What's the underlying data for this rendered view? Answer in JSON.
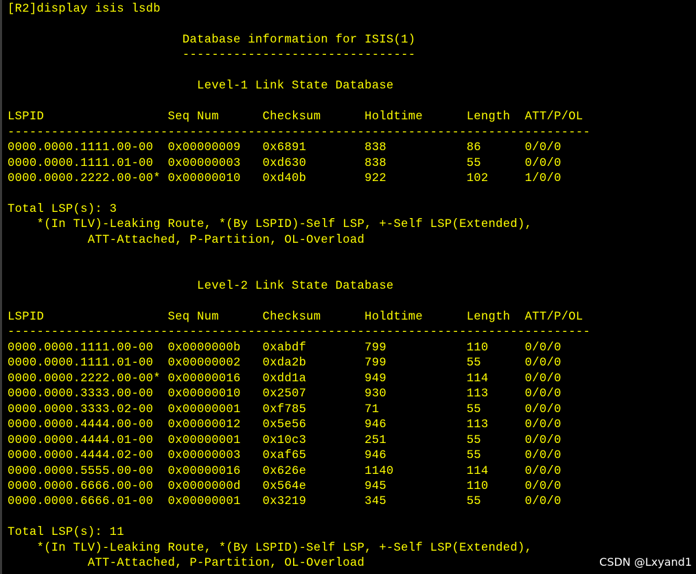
{
  "window": {
    "title": "",
    "watermark": "CSDN @Lxyand1"
  },
  "terminal": {
    "lines": [
      "[R2]display isis lsdb",
      "",
      "                        Database information for ISIS(1)",
      "                        --------------------------------",
      "",
      "                          Level-1 Link State Database",
      "",
      "LSPID                 Seq Num      Checksum      Holdtime      Length  ATT/P/OL",
      "--------------------------------------------------------------------------------",
      "0000.0000.1111.00-00  0x00000009   0x6891        838           86      0/0/0",
      "0000.0000.1111.01-00  0x00000003   0xd630        838           55      0/0/0",
      "0000.0000.2222.00-00* 0x00000010   0xd40b        922           102     1/0/0",
      "",
      "Total LSP(s): 3",
      "    *(In TLV)-Leaking Route, *(By LSPID)-Self LSP, +-Self LSP(Extended),",
      "           ATT-Attached, P-Partition, OL-Overload",
      "",
      "",
      "                          Level-2 Link State Database",
      "",
      "LSPID                 Seq Num      Checksum      Holdtime      Length  ATT/P/OL",
      "--------------------------------------------------------------------------------",
      "0000.0000.1111.00-00  0x0000000b   0xabdf        799           110     0/0/0",
      "0000.0000.1111.01-00  0x00000002   0xda2b        799           55      0/0/0",
      "0000.0000.2222.00-00* 0x00000016   0xdd1a        949           114     0/0/0",
      "0000.0000.3333.00-00  0x00000010   0x2507        930           113     0/0/0",
      "0000.0000.3333.02-00  0x00000001   0xf785        71            55      0/0/0",
      "0000.0000.4444.00-00  0x00000012   0x5e56        946           113     0/0/0",
      "0000.0000.4444.01-00  0x00000001   0x10c3        251           55      0/0/0",
      "0000.0000.4444.02-00  0x00000003   0xaf65        946           55      0/0/0",
      "0000.0000.5555.00-00  0x00000016   0x626e        1140          114     0/0/0",
      "0000.0000.6666.00-00  0x0000000d   0x564e        945           110     0/0/0",
      "0000.0000.6666.01-00  0x00000001   0x3219        345           55      0/0/0",
      "",
      "Total LSP(s): 11",
      "    *(In TLV)-Leaking Route, *(By LSPID)-Self LSP, +-Self LSP(Extended),",
      "           ATT-Attached, P-Partition, OL-Overload"
    ]
  },
  "colors": {
    "background": "#000000",
    "text": "#ffff00",
    "watermark": "#ffffff"
  }
}
